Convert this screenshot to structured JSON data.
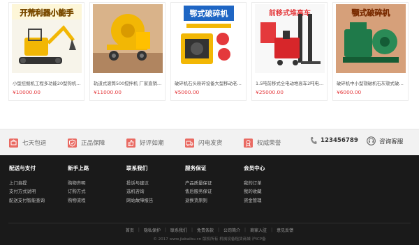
{
  "products": [
    {
      "name": "小型挖掘机工程多功能20型钩机家用农用",
      "price": "¥10000.00",
      "image_text": "开荒利器小能手",
      "icon": "mini-excavator-icon"
    },
    {
      "name": "轨道式滚筒500搅拌机 厂家直销混凝土",
      "price": "¥11000.00",
      "image_text": "",
      "icon": "concrete-mixer-icon"
    },
    {
      "name": "破碎机石头粉碎设备大型移动老式颚式破碎机",
      "price": "¥5000.00",
      "image_text": "鄂式破碎机",
      "icon": "jaw-crusher-icon"
    },
    {
      "name": "1.5吨前移式全电动堆高车2吨电动叉车",
      "price": "¥25000.00",
      "image_text": "前移式堆高车",
      "icon": "electric-stacker-icon"
    },
    {
      "name": "破碎机中小型颚破机石灰颚式破碎机",
      "price": "¥6000.00",
      "image_text": "颚式破碎机",
      "icon": "green-crusher-icon"
    }
  ],
  "services": [
    {
      "label": "七天包退",
      "icon": "return-7day-icon"
    },
    {
      "label": "正品保障",
      "icon": "shield-check-icon"
    },
    {
      "label": "好评如潮",
      "icon": "thumbs-up-icon"
    },
    {
      "label": "闪电发货",
      "icon": "truck-icon"
    },
    {
      "label": "权威荣誉",
      "icon": "award-icon"
    }
  ],
  "phone": {
    "number": "123456789",
    "icon": "phone-icon"
  },
  "customer_service": {
    "label": "咨询客服",
    "icon": "headset-icon"
  },
  "footer_columns": [
    {
      "title": "配送与支付",
      "links": [
        "上门自提",
        "支付方式说明",
        "配送支付智能查询"
      ]
    },
    {
      "title": "新手上路",
      "links": [
        "购物声明",
        "订购方式",
        "购物流程"
      ]
    },
    {
      "title": "联系我们",
      "links": [
        "投诉与建议",
        "选机咨询",
        "网站故障报告"
      ]
    },
    {
      "title": "服务保证",
      "links": [
        "产品质量保证",
        "售后服务保证",
        "退换货原则"
      ]
    },
    {
      "title": "会员中心",
      "links": [
        "我的订单",
        "我的收藏",
        "资金管理"
      ]
    }
  ],
  "footer_links": [
    "首页",
    "隐私保护",
    "联系我们",
    "免责条款",
    "公司简介",
    "商家入驻",
    "意见反馈"
  ],
  "copyright": "© 2017 www.jiabaibu.cn 版权所有  机械设备租赁商城  沪ICP备",
  "colors": {
    "price": "#e4393c",
    "service_icon": "#e96a62",
    "footer_bg": "#1a1a1a"
  }
}
